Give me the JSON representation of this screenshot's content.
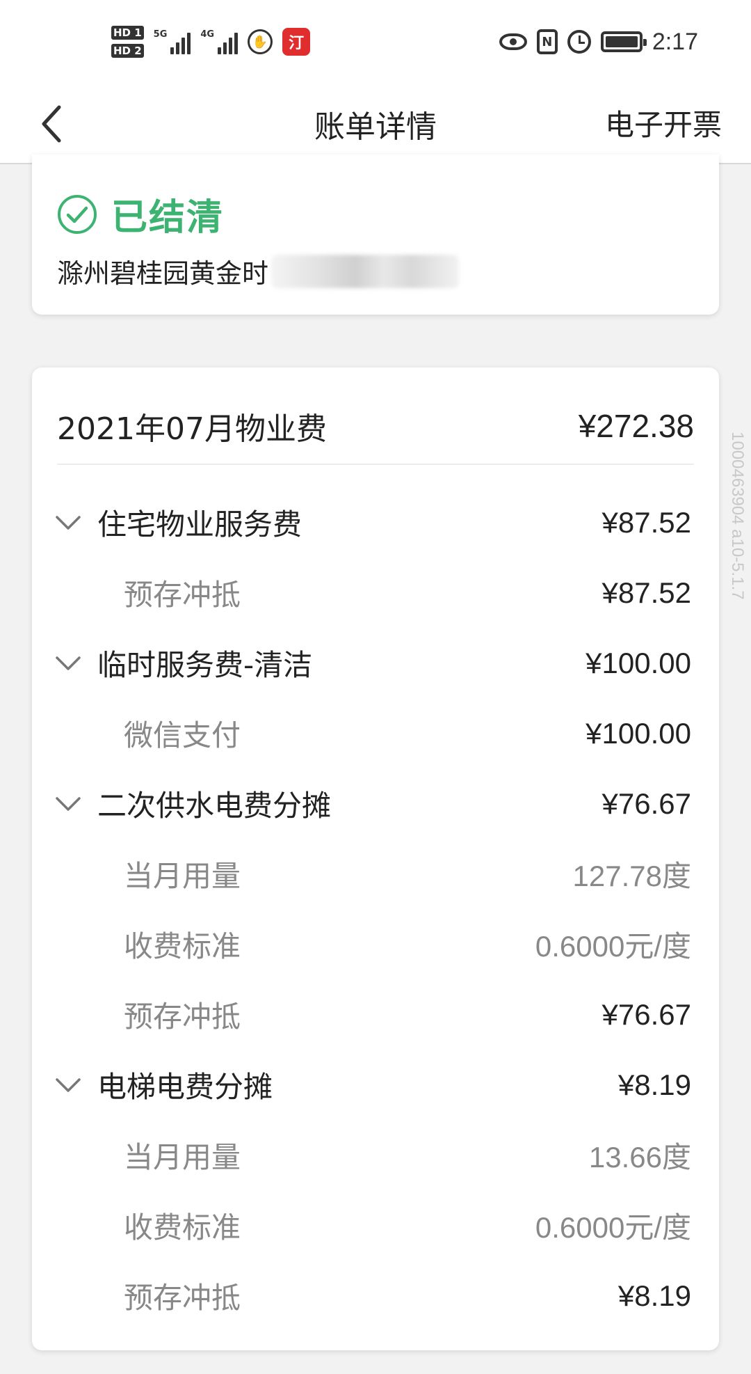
{
  "status_bar": {
    "hd1": "HD 1",
    "hd2": "HD 2",
    "net1": "5G",
    "net2": "4G",
    "app_icon_text": "汀",
    "time": "2:17",
    "nfc": "N"
  },
  "header": {
    "title": "账单详情",
    "action_label": "电子开票"
  },
  "status_card": {
    "status": "已结清",
    "address": "滁州碧桂园黄金时",
    "status_color": "#3cb371"
  },
  "bill": {
    "title": "2021年07月物业费",
    "total": "¥272.38",
    "groups": [
      {
        "label": "住宅物业服务费",
        "amount": "¥87.52",
        "details": [
          {
            "label": "预存冲抵",
            "value": "¥87.52",
            "tone": "dark"
          }
        ]
      },
      {
        "label": "临时服务费-清洁",
        "amount": "¥100.00",
        "details": [
          {
            "label": "微信支付",
            "value": "¥100.00",
            "tone": "dark"
          }
        ]
      },
      {
        "label": "二次供水电费分摊",
        "amount": "¥76.67",
        "details": [
          {
            "label": "当月用量",
            "value": "127.78度",
            "tone": "light"
          },
          {
            "label": "收费标准",
            "value": "0.6000元/度",
            "tone": "light"
          },
          {
            "label": "预存冲抵",
            "value": "¥76.67",
            "tone": "dark"
          }
        ]
      },
      {
        "label": "电梯电费分摊",
        "amount": "¥8.19",
        "details": [
          {
            "label": "当月用量",
            "value": "13.66度",
            "tone": "light"
          },
          {
            "label": "收费标准",
            "value": "0.6000元/度",
            "tone": "light"
          },
          {
            "label": "预存冲抵",
            "value": "¥8.19",
            "tone": "dark"
          }
        ]
      }
    ]
  },
  "watermark": "1000463904 a10-5.1.7"
}
